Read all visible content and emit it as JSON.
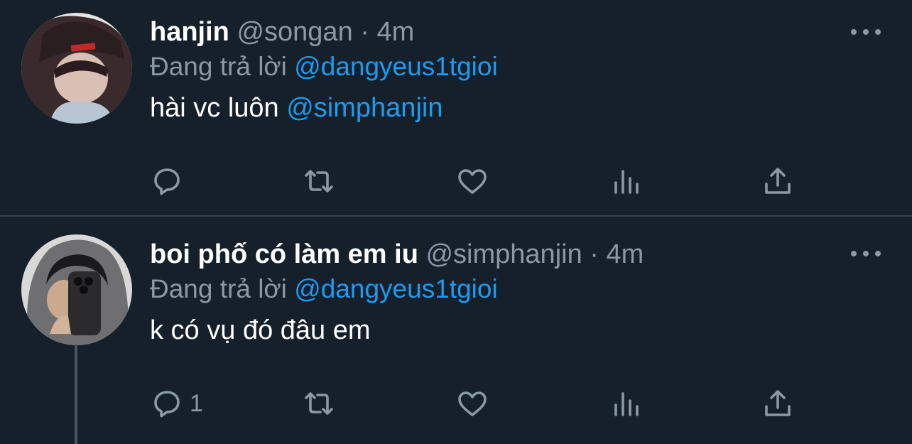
{
  "tweets": [
    {
      "name": "hanjin",
      "handle": "@songan",
      "separator": "·",
      "time": "4m",
      "replying_prefix": "Đang trả lời",
      "replying_to": "@dangyeus1tgioi",
      "text": "hài vc luôn",
      "text_mention": "@simphanjin",
      "reply_count": ""
    },
    {
      "name": "boi phố có làm em iu",
      "handle": "@simphanjin",
      "separator": "·",
      "time": "4m",
      "replying_prefix": "Đang trả lời",
      "replying_to": "@dangyeus1tgioi",
      "text": "k có vụ đó đâu em",
      "text_mention": "",
      "reply_count": "1"
    }
  ],
  "icons": {
    "reply": "reply-icon",
    "retweet": "retweet-icon",
    "like": "heart-icon",
    "views": "views-icon",
    "share": "share-icon",
    "more": "more-icon"
  },
  "colors": {
    "background": "#15202b",
    "accent": "#1d9bf0",
    "secondary_text": "#8b98a5",
    "divider": "#38444d"
  }
}
